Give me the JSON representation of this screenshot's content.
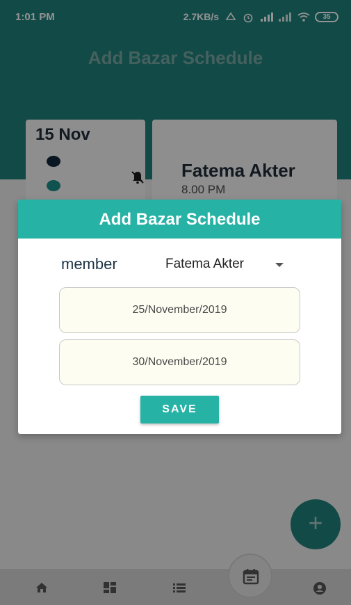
{
  "status_bar": {
    "time": "1:01 PM",
    "network_speed": "2.7KB/s",
    "battery": "35"
  },
  "header": {
    "title": "Add Bazar Schedule"
  },
  "background_card": {
    "date": "15 Nov",
    "member_name": "Fatema Akter",
    "time": "8.00 PM"
  },
  "dialog": {
    "title": "Add Bazar Schedule",
    "member_label": "member",
    "member_selected": "Fatema Akter",
    "start_date": "25/November/2019",
    "end_date": "30/November/2019",
    "save_label": "SAVE"
  },
  "fab": {
    "symbol": "+"
  },
  "bottom_nav": {
    "items": [
      "home-icon",
      "dashboard-icon",
      "list-icon",
      "calendar-icon",
      "account-icon"
    ]
  },
  "colors": {
    "primary": "#26b2a5",
    "primary_dark": "#1f807a",
    "field_background": "#fdfdf1"
  }
}
